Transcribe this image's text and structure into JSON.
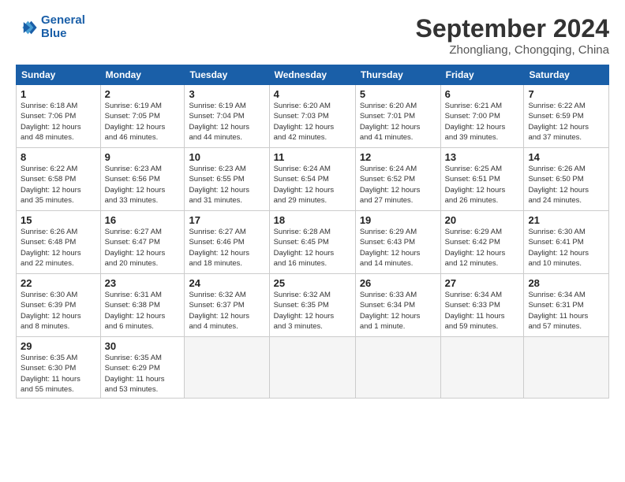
{
  "logo": {
    "line1": "General",
    "line2": "Blue"
  },
  "title": "September 2024",
  "subtitle": "Zhongliang, Chongqing, China",
  "headers": [
    "Sunday",
    "Monday",
    "Tuesday",
    "Wednesday",
    "Thursday",
    "Friday",
    "Saturday"
  ],
  "days": [
    {
      "num": "",
      "info": ""
    },
    {
      "num": "",
      "info": ""
    },
    {
      "num": "",
      "info": ""
    },
    {
      "num": "",
      "info": ""
    },
    {
      "num": "",
      "info": ""
    },
    {
      "num": "",
      "info": ""
    },
    {
      "num": "7",
      "info": "Sunrise: 6:22 AM\nSunset: 6:59 PM\nDaylight: 12 hours\nand 37 minutes."
    },
    {
      "num": "8",
      "info": "Sunrise: 6:22 AM\nSunset: 6:58 PM\nDaylight: 12 hours\nand 35 minutes."
    },
    {
      "num": "9",
      "info": "Sunrise: 6:23 AM\nSunset: 6:56 PM\nDaylight: 12 hours\nand 33 minutes."
    },
    {
      "num": "10",
      "info": "Sunrise: 6:23 AM\nSunset: 6:55 PM\nDaylight: 12 hours\nand 31 minutes."
    },
    {
      "num": "11",
      "info": "Sunrise: 6:24 AM\nSunset: 6:54 PM\nDaylight: 12 hours\nand 29 minutes."
    },
    {
      "num": "12",
      "info": "Sunrise: 6:24 AM\nSunset: 6:52 PM\nDaylight: 12 hours\nand 27 minutes."
    },
    {
      "num": "13",
      "info": "Sunrise: 6:25 AM\nSunset: 6:51 PM\nDaylight: 12 hours\nand 26 minutes."
    },
    {
      "num": "14",
      "info": "Sunrise: 6:26 AM\nSunset: 6:50 PM\nDaylight: 12 hours\nand 24 minutes."
    },
    {
      "num": "15",
      "info": "Sunrise: 6:26 AM\nSunset: 6:48 PM\nDaylight: 12 hours\nand 22 minutes."
    },
    {
      "num": "16",
      "info": "Sunrise: 6:27 AM\nSunset: 6:47 PM\nDaylight: 12 hours\nand 20 minutes."
    },
    {
      "num": "17",
      "info": "Sunrise: 6:27 AM\nSunset: 6:46 PM\nDaylight: 12 hours\nand 18 minutes."
    },
    {
      "num": "18",
      "info": "Sunrise: 6:28 AM\nSunset: 6:45 PM\nDaylight: 12 hours\nand 16 minutes."
    },
    {
      "num": "19",
      "info": "Sunrise: 6:29 AM\nSunset: 6:43 PM\nDaylight: 12 hours\nand 14 minutes."
    },
    {
      "num": "20",
      "info": "Sunrise: 6:29 AM\nSunset: 6:42 PM\nDaylight: 12 hours\nand 12 minutes."
    },
    {
      "num": "21",
      "info": "Sunrise: 6:30 AM\nSunset: 6:41 PM\nDaylight: 12 hours\nand 10 minutes."
    },
    {
      "num": "22",
      "info": "Sunrise: 6:30 AM\nSunset: 6:39 PM\nDaylight: 12 hours\nand 8 minutes."
    },
    {
      "num": "23",
      "info": "Sunrise: 6:31 AM\nSunset: 6:38 PM\nDaylight: 12 hours\nand 6 minutes."
    },
    {
      "num": "24",
      "info": "Sunrise: 6:32 AM\nSunset: 6:37 PM\nDaylight: 12 hours\nand 4 minutes."
    },
    {
      "num": "25",
      "info": "Sunrise: 6:32 AM\nSunset: 6:35 PM\nDaylight: 12 hours\nand 3 minutes."
    },
    {
      "num": "26",
      "info": "Sunrise: 6:33 AM\nSunset: 6:34 PM\nDaylight: 12 hours\nand 1 minute."
    },
    {
      "num": "27",
      "info": "Sunrise: 6:34 AM\nSunset: 6:33 PM\nDaylight: 11 hours\nand 59 minutes."
    },
    {
      "num": "28",
      "info": "Sunrise: 6:34 AM\nSunset: 6:31 PM\nDaylight: 11 hours\nand 57 minutes."
    },
    {
      "num": "29",
      "info": "Sunrise: 6:35 AM\nSunset: 6:30 PM\nDaylight: 11 hours\nand 55 minutes."
    },
    {
      "num": "30",
      "info": "Sunrise: 6:35 AM\nSunset: 6:29 PM\nDaylight: 11 hours\nand 53 minutes."
    },
    {
      "num": "",
      "info": ""
    },
    {
      "num": "",
      "info": ""
    },
    {
      "num": "",
      "info": ""
    },
    {
      "num": "",
      "info": ""
    },
    {
      "num": "",
      "info": ""
    }
  ],
  "week1": [
    {
      "num": "1",
      "info": "Sunrise: 6:18 AM\nSunset: 7:06 PM\nDaylight: 12 hours\nand 48 minutes."
    },
    {
      "num": "2",
      "info": "Sunrise: 6:19 AM\nSunset: 7:05 PM\nDaylight: 12 hours\nand 46 minutes."
    },
    {
      "num": "3",
      "info": "Sunrise: 6:19 AM\nSunset: 7:04 PM\nDaylight: 12 hours\nand 44 minutes."
    },
    {
      "num": "4",
      "info": "Sunrise: 6:20 AM\nSunset: 7:03 PM\nDaylight: 12 hours\nand 42 minutes."
    },
    {
      "num": "5",
      "info": "Sunrise: 6:20 AM\nSunset: 7:01 PM\nDaylight: 12 hours\nand 41 minutes."
    },
    {
      "num": "6",
      "info": "Sunrise: 6:21 AM\nSunset: 7:00 PM\nDaylight: 12 hours\nand 39 minutes."
    },
    {
      "num": "7",
      "info": "Sunrise: 6:22 AM\nSunset: 6:59 PM\nDaylight: 12 hours\nand 37 minutes."
    }
  ]
}
